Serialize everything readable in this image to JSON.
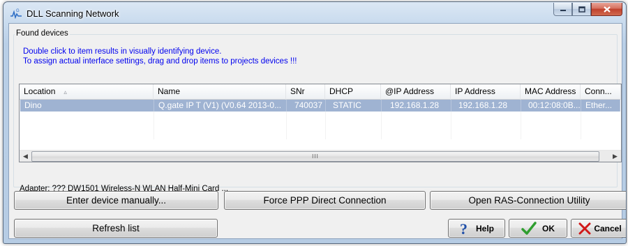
{
  "window": {
    "title": "DLL Scanning Network"
  },
  "group": {
    "legend": "Found devices",
    "info_line1": "Double click to item results in visually identifying device.",
    "info_line2": "To assign actual interface settings, drag and drop items to projects devices !!!"
  },
  "list": {
    "columns": [
      {
        "label": "Location"
      },
      {
        "label": "Name"
      },
      {
        "label": "SNr"
      },
      {
        "label": "DHCP"
      },
      {
        "label": "@IP Address"
      },
      {
        "label": "IP Address"
      },
      {
        "label": "MAC Address"
      },
      {
        "label": "Conn..."
      }
    ],
    "rows": [
      {
        "location": "Dino",
        "name": "Q.gate IP T (V1) (V0.64 2013-0...",
        "snr": "740037",
        "dhcp": "STATIC",
        "at_ip": "192.168.1.28",
        "ip": "192.168.1.28",
        "mac": "00:12:08:0B...",
        "conn": "Ether..."
      }
    ],
    "scroll_grip": "III"
  },
  "adapter": {
    "label": "Adapter: ???",
    "value": "DW1501 Wireless-N WLAN Half-Mini Card ..."
  },
  "buttons": {
    "enter_manually": "Enter device manually...",
    "force_ppp": "Force PPP Direct Connection",
    "open_ras": "Open RAS-Connection Utility",
    "refresh": "Refresh list",
    "help": "Help",
    "ok": "OK",
    "cancel": "Cancel"
  },
  "icons": {
    "app": "network-scan-icon",
    "help": "question-mark-icon",
    "ok": "checkmark-icon",
    "cancel": "x-mark-icon"
  },
  "colors": {
    "selection_row": "#9fb3d2",
    "info_text": "#0000ee",
    "ok_check": "#2f9e2f",
    "cancel_x": "#d01818",
    "help_q": "#1f4fa8"
  }
}
